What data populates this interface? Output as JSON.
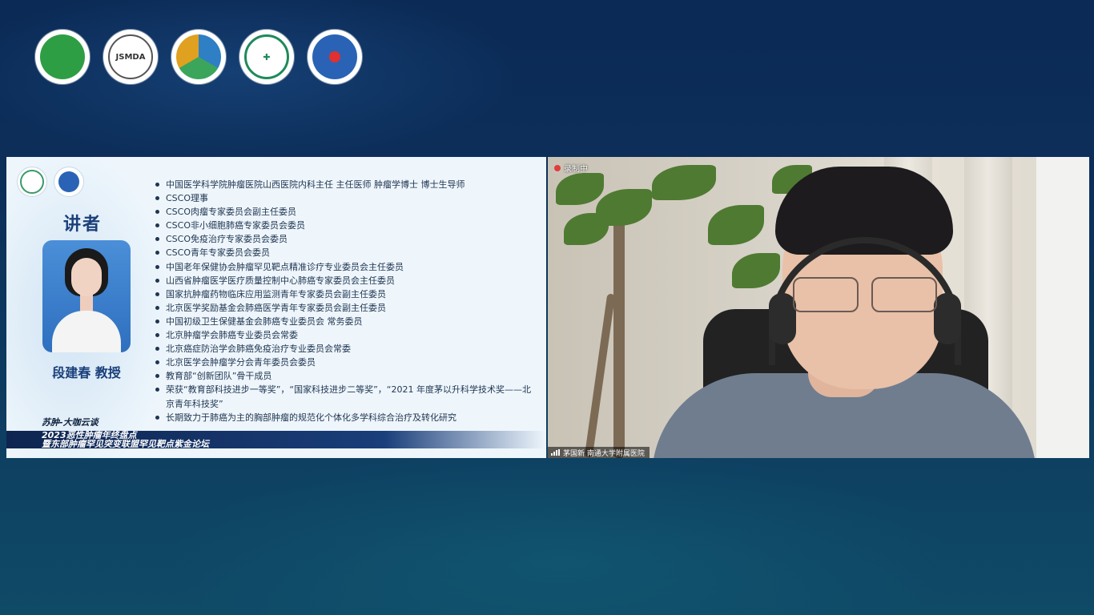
{
  "header_logos": [
    {
      "icon": "jiangsu-anti-cancer-society-logo"
    },
    {
      "icon": "jsmda-logo",
      "text": "JSMDA"
    },
    {
      "icon": "jiangsu-research-hospital-association-logo"
    },
    {
      "icon": "jiangsu-cancer-hospital-logo"
    },
    {
      "icon": "rare-tumor-alliance-logo"
    }
  ],
  "slide": {
    "speaker_label": "讲者",
    "speaker_name": "段建春 教授",
    "bio": [
      "中国医学科学院肿瘤医院山西医院内科主任  主任医师 肿瘤学博士 博士生导师",
      "CSCO理事",
      "CSCO肉瘤专家委员会副主任委员",
      "CSCO非小细胞肺癌专家委员会委员",
      "CSCO免疫治疗专家委员会委员",
      "CSCO青年专家委员会委员",
      "中国老年保健协会肿瘤罕见靶点精准诊疗专业委员会主任委员",
      "山西省肿瘤医学医疗质量控制中心肺癌专家委员会主任委员",
      "国家抗肿瘤药物临床应用监测青年专家委员会副主任委员",
      "北京医学奖励基金会肺癌医学青年专家委员会副主任委员",
      "中国初级卫生保健基金会肺癌专业委员会 常务委员",
      "北京肿瘤学会肺癌专业委员会常委",
      "北京癌症防治学会肺癌免疫治疗专业委员会常委",
      "北京医学会肿瘤学分会青年委员会委员",
      "教育部“创新团队”骨干成员",
      "荣获“教育部科技进步一等奖”，“国家科技进步二等奖”，“2021 年度茅以升科学技术奖——北京青年科技奖”",
      "长期致力于肺癌为主的胸部肿瘤的规范化个体化多学科综合治疗及转化研究"
    ],
    "banner": {
      "line1": "苏肿-大咖云谈",
      "line2": "2023恶性肿瘤年终盘点",
      "line3": "暨东部肿瘤罕见突变联盟罕见靶点紫金论坛"
    }
  },
  "video": {
    "status_text": "录制中",
    "participant_name": "茅国新 南通大学附属医院"
  }
}
